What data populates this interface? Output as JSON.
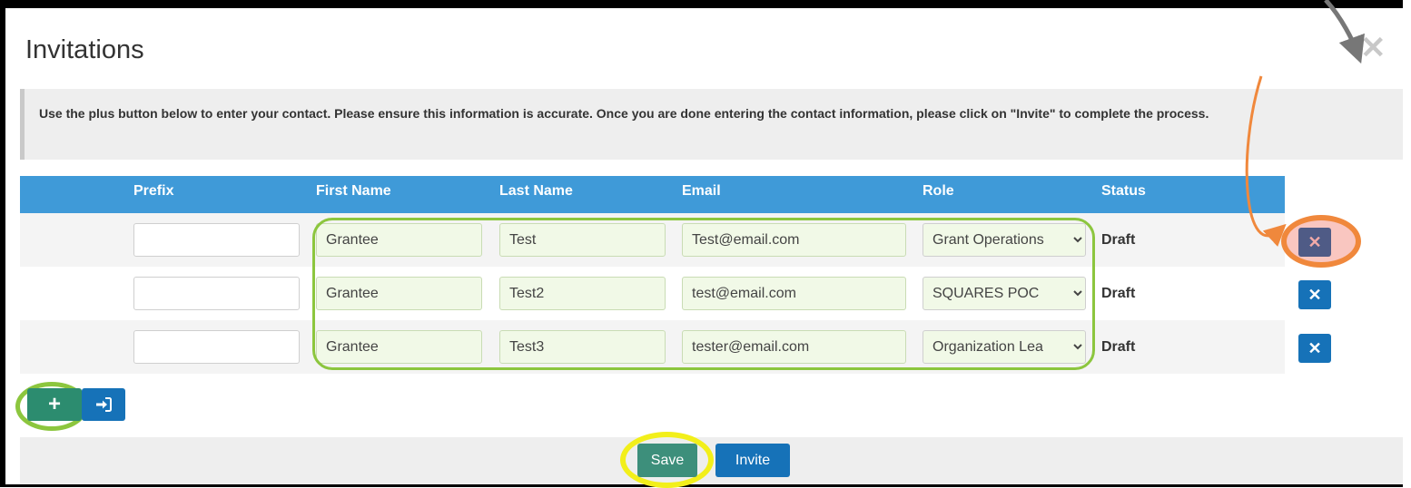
{
  "modal": {
    "title": "Invitations",
    "close_glyph": "✕",
    "instructions": "Use the plus button below to enter your contact. Please ensure this information is accurate. Once you are done entering the contact information, please click on \"Invite\" to complete the process."
  },
  "table": {
    "headers": {
      "prefix": "Prefix",
      "first_name": "First Name",
      "last_name": "Last Name",
      "email": "Email",
      "role": "Role",
      "status": "Status"
    },
    "rows": [
      {
        "prefix": "",
        "first_name": "Grantee",
        "last_name": "Test",
        "email": "Test@email.com",
        "role": "Grant Operations",
        "status": "Draft"
      },
      {
        "prefix": "",
        "first_name": "Grantee",
        "last_name": "Test2",
        "email": "test@email.com",
        "role": "SQUARES POC",
        "status": "Draft"
      },
      {
        "prefix": "",
        "first_name": "Grantee",
        "last_name": "Test3",
        "email": "tester@email.com",
        "role": "Organization Lea",
        "status": "Draft"
      }
    ]
  },
  "actions": {
    "add_glyph": "+",
    "save_label": "Save",
    "invite_label": "Invite"
  },
  "icons": {
    "close": "close-icon",
    "delete": "times-icon",
    "add": "plus-icon",
    "import": "sign-in-icon",
    "select": "chevron-down-icon"
  },
  "colors": {
    "header_blue": "#3f9ad8",
    "button_blue": "#1672b8",
    "save_green": "#3d8f7b",
    "annotation_orange": "#f0883c",
    "annotation_green": "#8cc63e",
    "annotation_yellow": "#f2ef1a"
  }
}
